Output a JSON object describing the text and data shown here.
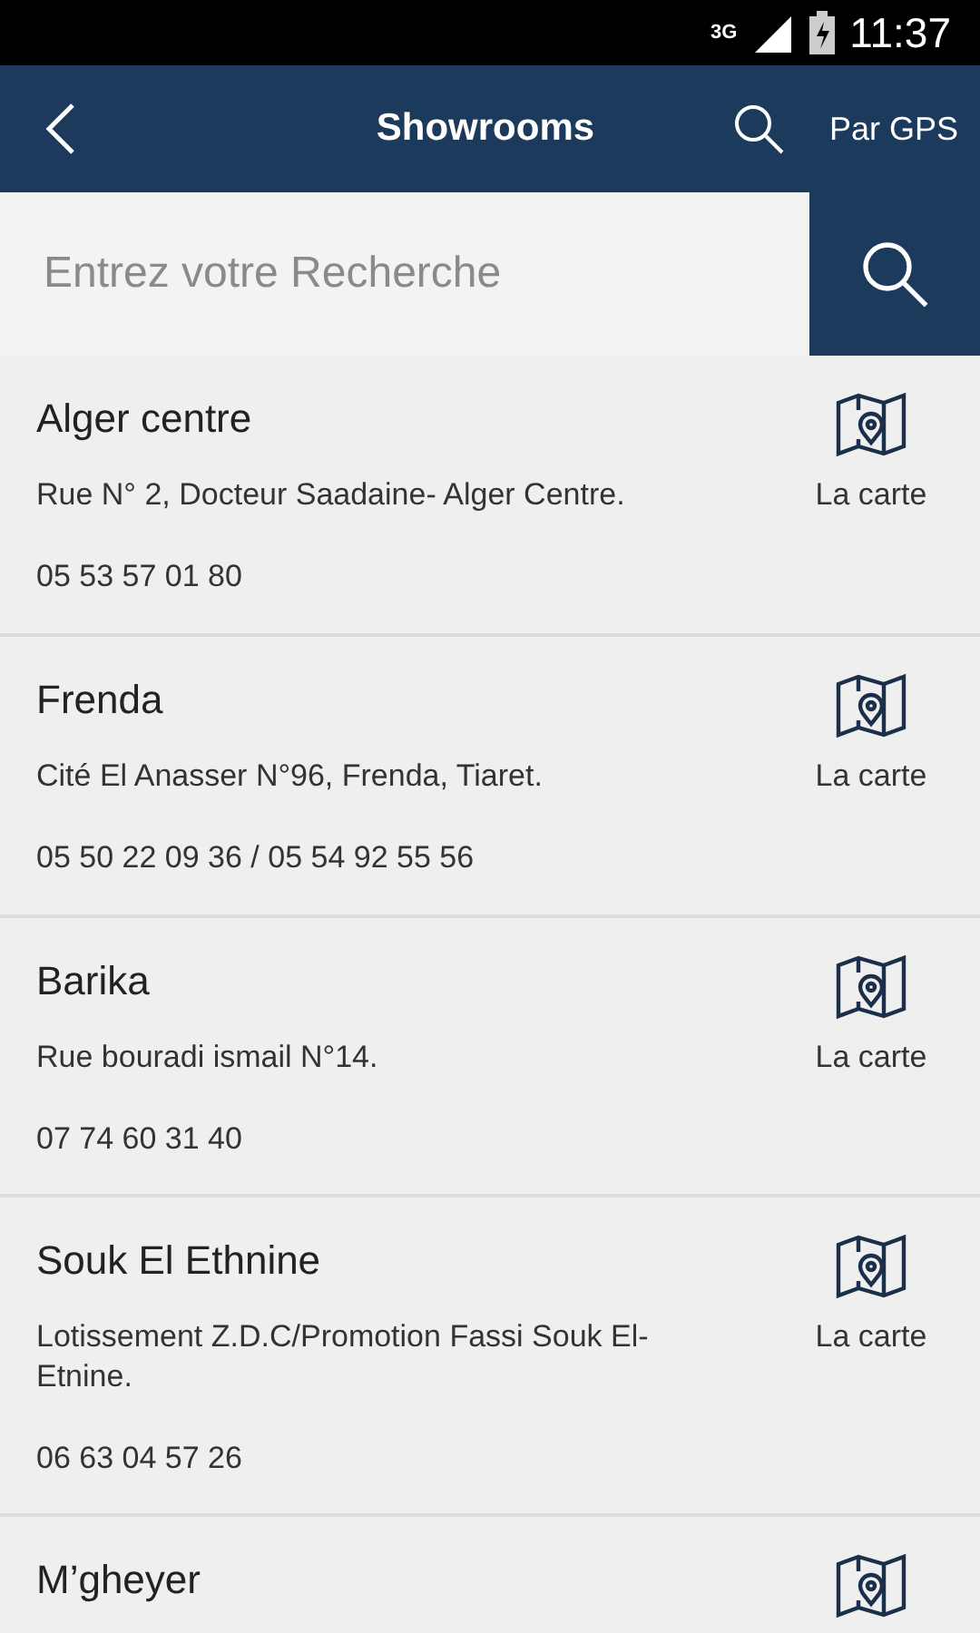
{
  "status_bar": {
    "network": "3G",
    "time": "11:37"
  },
  "app_bar": {
    "title": "Showrooms",
    "gps_button": "Par GPS"
  },
  "search": {
    "placeholder": "Entrez votre Recherche"
  },
  "showrooms": [
    {
      "name": "Alger centre",
      "address": "Rue N° 2, Docteur Saadaine- Alger Centre.",
      "phone": "05 53 57 01 80",
      "map_label": "La carte"
    },
    {
      "name": "Frenda",
      "address": "Cité El Anasser N°96, Frenda, Tiaret.",
      "phone": "05 50 22 09 36 / 05 54 92 55 56",
      "map_label": "La carte"
    },
    {
      "name": "Barika",
      "address": "Rue bouradi ismail N°14.",
      "phone": "07 74 60 31 40",
      "map_label": "La carte"
    },
    {
      "name": "Souk El Ethnine",
      "address": "Lotissement Z.D.C/Promotion Fassi Souk El-Etnine.",
      "phone": "06 63 04 57 26",
      "map_label": "La carte"
    },
    {
      "name": "M’gheyer"
    }
  ]
}
